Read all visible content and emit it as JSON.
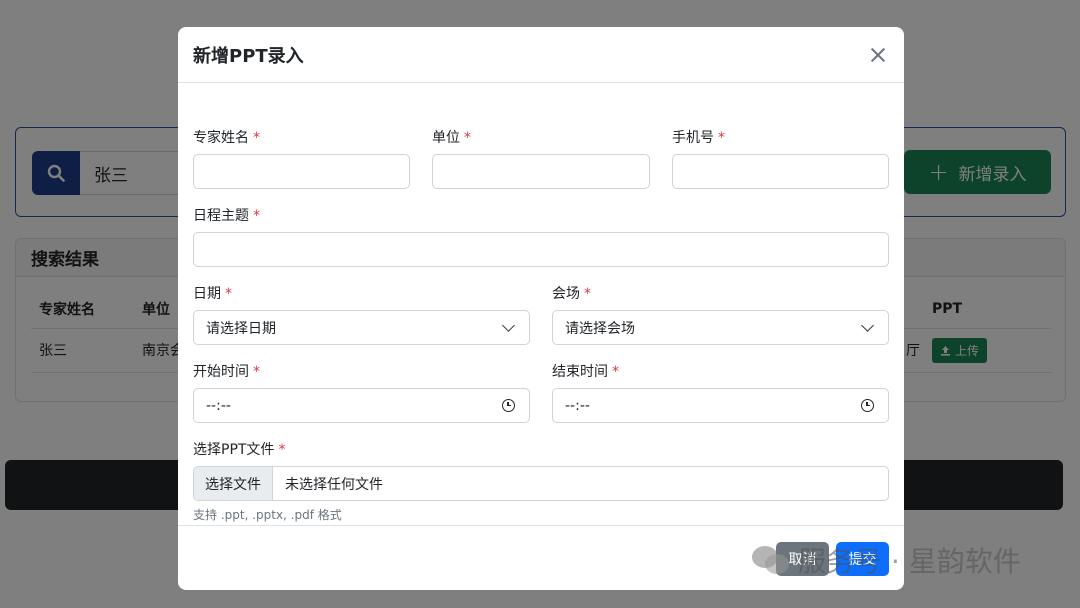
{
  "background": {
    "search": {
      "value": "张三",
      "icon": "search-icon"
    },
    "add_button_label": "新增录入",
    "results": {
      "title": "搜索结果",
      "columns": [
        "专家姓名",
        "单位",
        "",
        "",
        "",
        "",
        "PPT"
      ],
      "rows": [
        {
          "name": "张三",
          "unit": "南京会",
          "tail": "厅",
          "upload_label": "上传"
        }
      ]
    }
  },
  "modal": {
    "title": "新增PPT录入",
    "required_mark": "*",
    "fields": {
      "expert_name": {
        "label": "专家姓名",
        "value": ""
      },
      "unit": {
        "label": "单位",
        "value": ""
      },
      "phone": {
        "label": "手机号",
        "value": ""
      },
      "topic": {
        "label": "日程主题",
        "value": ""
      },
      "date": {
        "label": "日期",
        "value": "请选择日期"
      },
      "venue": {
        "label": "会场",
        "value": "请选择会场"
      },
      "start_time": {
        "label": "开始时间",
        "value": "--:--"
      },
      "end_time": {
        "label": "结束时间",
        "value": "--:--"
      },
      "file": {
        "label": "选择PPT文件",
        "button": "选择文件",
        "status": "未选择任何文件",
        "help": "支持 .ppt, .pptx, .pdf 格式"
      }
    },
    "buttons": {
      "cancel": "取消",
      "submit": "提交"
    }
  },
  "watermark": {
    "text": "服务号 · 星韵软件"
  },
  "colors": {
    "primary": "#0d6efd",
    "success": "#198754",
    "secondary": "#6c757d",
    "danger": "#dc3545",
    "navy": "#1f3c88"
  }
}
